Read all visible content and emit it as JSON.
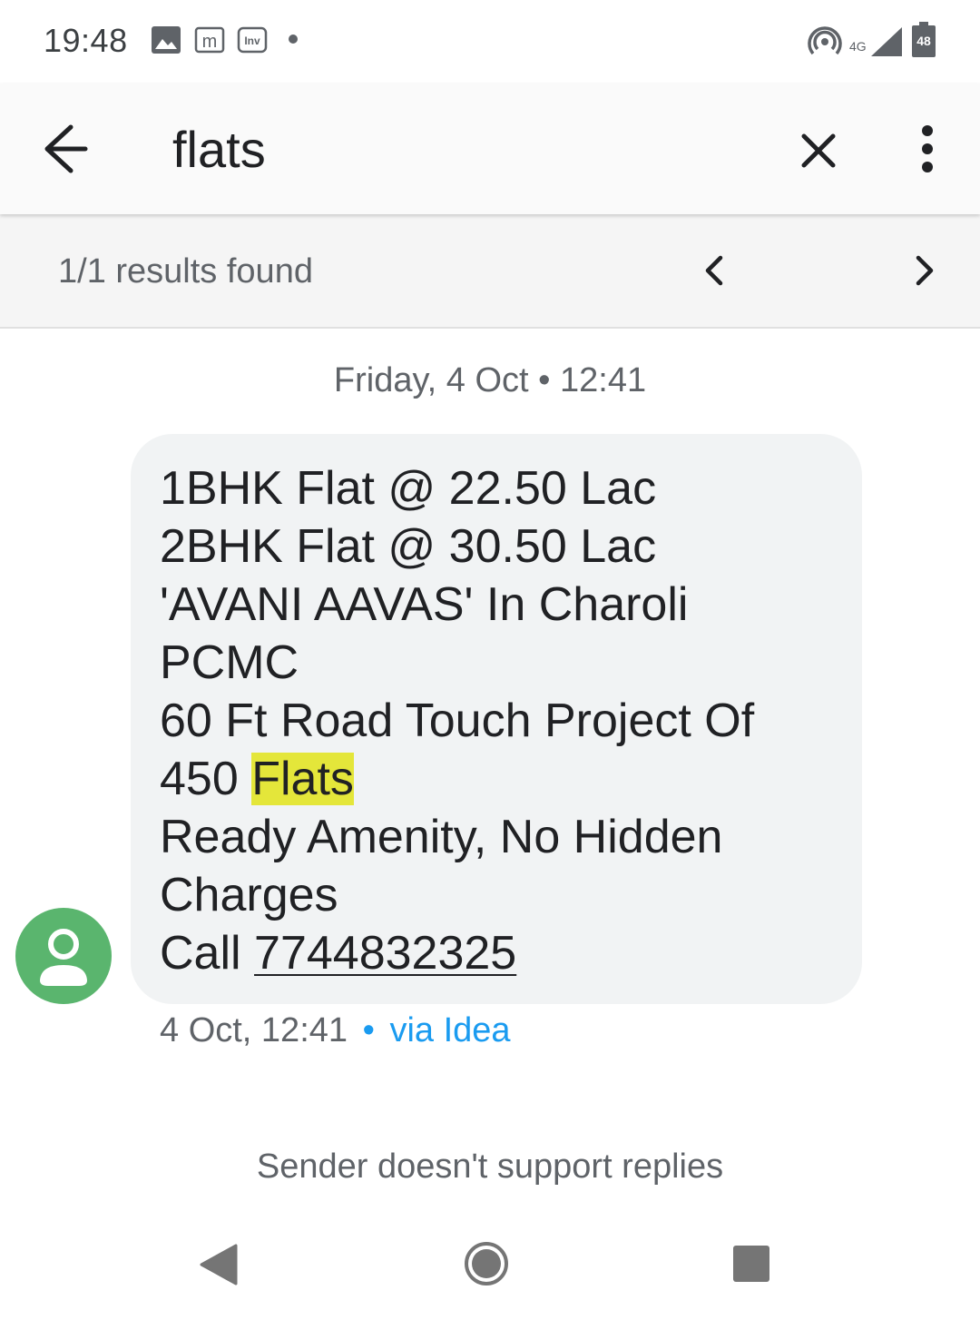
{
  "status_bar": {
    "time": "19:48",
    "icons": [
      "image-icon",
      "m-app-icon",
      "inv-app-icon",
      "notification-dot",
      "hotspot-icon",
      "signal-4g-icon",
      "battery-icon"
    ],
    "network": "4G",
    "battery": "48"
  },
  "search": {
    "query": "flats",
    "back_icon": "arrow-back-icon",
    "clear_icon": "close-icon",
    "menu_icon": "more-vert-icon"
  },
  "results": {
    "text": "1/1 results found",
    "prev_icon": "chevron-left-icon",
    "next_icon": "chevron-right-icon"
  },
  "conversation": {
    "date_header": "Friday, 4 Oct • 12:41",
    "message": {
      "lines": [
        "1BHK Flat @ 22.50 Lac",
        "2BHK Flat @ 30.50 Lac",
        "'AVANI AAVAS' In Charoli",
        "PCMC",
        "60 Ft Road Touch Project Of"
      ],
      "line6_prefix": "450 ",
      "line6_highlight": "Flats",
      "lines_after": [
        "Ready Amenity, No Hidden",
        "Charges"
      ],
      "call_prefix": "Call ",
      "phone": "7744832325"
    },
    "meta_time": "4 Oct, 12:41",
    "meta_dot": "•",
    "meta_via": "via Idea",
    "avatar_color": "#5ab56e",
    "highlight_color": "#e4e63a"
  },
  "footer": {
    "no_reply_text": "Sender doesn't support replies"
  },
  "nav": {
    "back_icon": "nav-back-icon",
    "home_icon": "nav-home-icon",
    "recents_icon": "nav-recents-icon"
  }
}
